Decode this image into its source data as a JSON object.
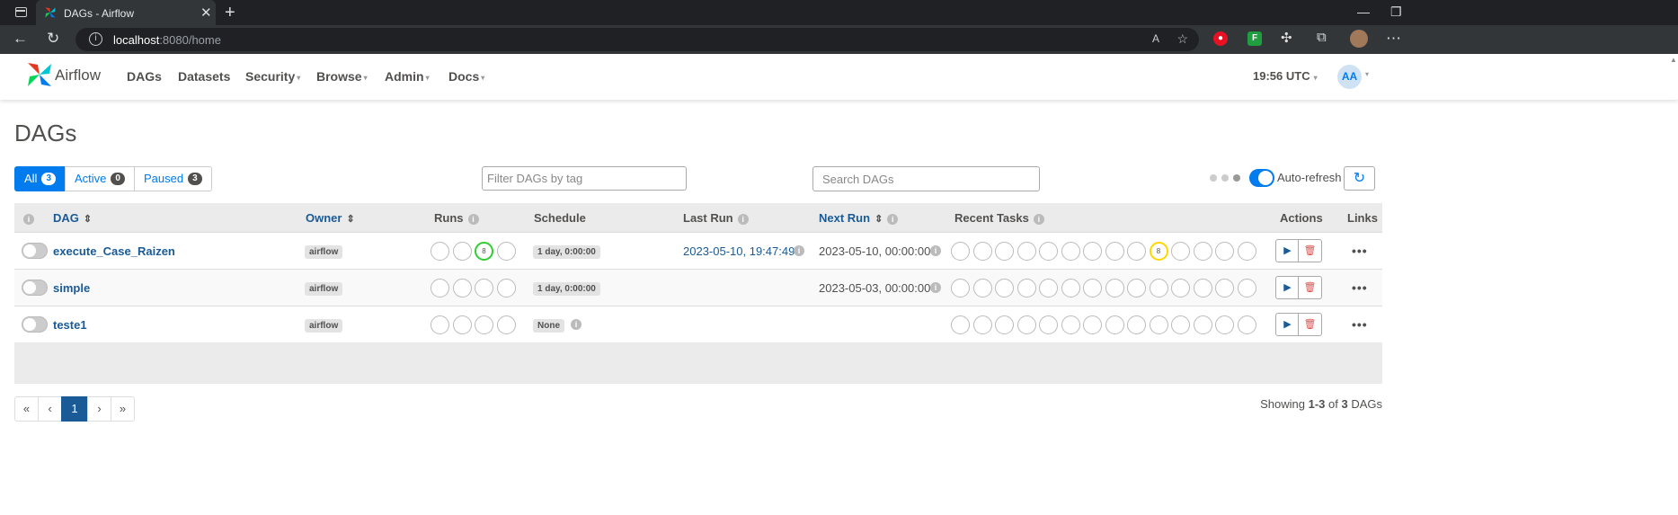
{
  "browser": {
    "tab_title": "DAGs - Airflow",
    "url_host": "localhost",
    "url_path": ":8080/home",
    "new_tab": "+",
    "close_tab": "✕"
  },
  "nav": {
    "brand": "Airflow",
    "items": [
      "DAGs",
      "Datasets",
      "Security",
      "Browse",
      "Admin",
      "Docs"
    ],
    "time": "19:56 UTC",
    "avatar": "AA"
  },
  "page": {
    "title": "DAGs",
    "filters": [
      {
        "label": "All",
        "count": "3"
      },
      {
        "label": "Active",
        "count": "0"
      },
      {
        "label": "Paused",
        "count": "3"
      }
    ],
    "tag_filter_placeholder": "Filter DAGs by tag",
    "search_placeholder": "Search DAGs",
    "auto_refresh_label": "Auto-refresh"
  },
  "table": {
    "headers": {
      "dag": "DAG",
      "owner": "Owner",
      "runs": "Runs",
      "schedule": "Schedule",
      "last_run": "Last Run",
      "next_run": "Next Run",
      "recent_tasks": "Recent Tasks",
      "actions": "Actions",
      "links": "Links"
    },
    "rows": [
      {
        "name": "execute_Case_Raizen",
        "owner": "airflow",
        "run_count": "8",
        "schedule": "1 day, 0:00:00",
        "last_run": "2023-05-10, 19:47:49",
        "next_run": "2023-05-10, 00:00:00",
        "task_count": "8"
      },
      {
        "name": "simple",
        "owner": "airflow",
        "schedule": "1 day, 0:00:00",
        "last_run": "",
        "next_run": "2023-05-03, 00:00:00"
      },
      {
        "name": "teste1",
        "owner": "airflow",
        "schedule": "None",
        "last_run": "",
        "next_run": ""
      }
    ]
  },
  "pagination": {
    "first": "«",
    "prev": "‹",
    "current": "1",
    "next": "›",
    "last": "»",
    "showing_prefix": "Showing ",
    "showing_range": "1-3",
    "showing_of": " of ",
    "showing_total": "3",
    "showing_suffix": " DAGs"
  },
  "colors": {
    "accent": "#017cee",
    "link": "#1a5a96",
    "success": "#32cd32",
    "running": "#ffd700"
  }
}
